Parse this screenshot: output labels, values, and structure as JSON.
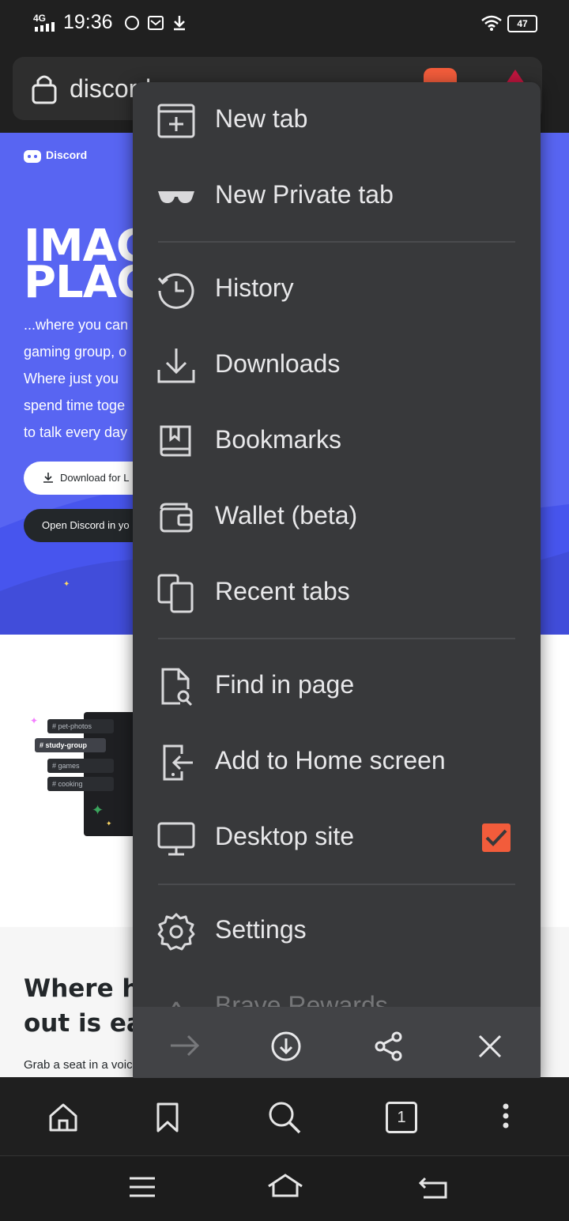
{
  "status_bar": {
    "network": "4G",
    "time": "19:36",
    "battery": "47"
  },
  "address_bar": {
    "url": "discord"
  },
  "page": {
    "logo_text": "Discord",
    "hero_title_1": "IMAG",
    "hero_title_2": "PLAC",
    "hero_lines": [
      "...where you can",
      "gaming group, o",
      "Where just you",
      "spend time toge",
      "to talk every day"
    ],
    "download_button": "Download for L",
    "open_button": "Open Discord in yo",
    "channels": [
      "pet-photos",
      "study-group",
      "games",
      "cooking"
    ],
    "section_title_1": "Where h",
    "section_title_2": "out is ea",
    "section_text": "Grab a seat in a voic"
  },
  "menu": {
    "items": [
      {
        "label": "New tab",
        "icon": "new-tab-icon"
      },
      {
        "label": "New Private tab",
        "icon": "private-glasses-icon"
      },
      {
        "label": "History",
        "icon": "history-icon"
      },
      {
        "label": "Downloads",
        "icon": "download-icon"
      },
      {
        "label": "Bookmarks",
        "icon": "bookmarks-icon"
      },
      {
        "label": "Wallet (beta)",
        "icon": "wallet-icon"
      },
      {
        "label": "Recent tabs",
        "icon": "recent-tabs-icon"
      },
      {
        "label": "Find in page",
        "icon": "find-in-page-icon"
      },
      {
        "label": "Add to Home screen",
        "icon": "add-to-home-icon"
      },
      {
        "label": "Desktop site",
        "icon": "desktop-icon",
        "checked": true
      },
      {
        "label": "Settings",
        "icon": "gear-icon"
      },
      {
        "label": "Brave Rewards",
        "icon": "rewards-icon"
      }
    ],
    "accent_color": "#f25c3b"
  },
  "toolbar": {
    "tab_count": "1"
  }
}
